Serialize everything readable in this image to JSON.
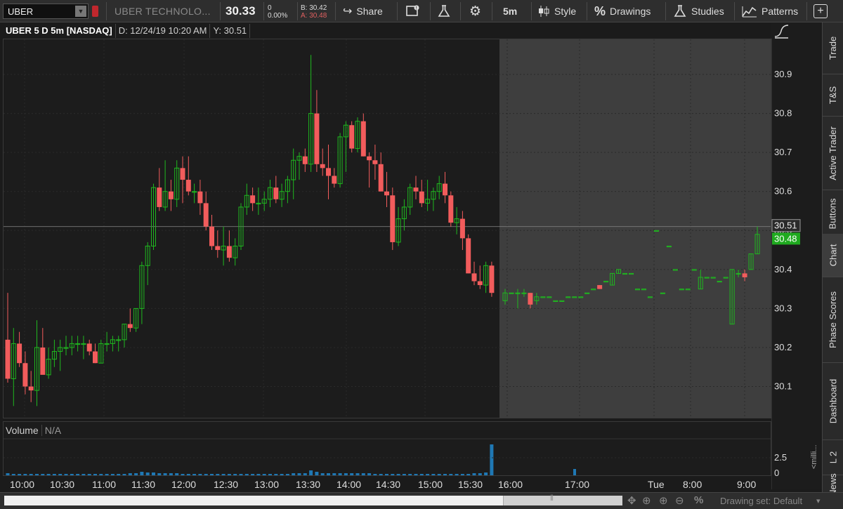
{
  "toolbar": {
    "symbol": "UBER",
    "company": "UBER TECHNOLO...",
    "last_price": "30.33",
    "change": "0",
    "change_pct": "0.00%",
    "bid": "B: 30.42",
    "ask": "A: 30.48",
    "share_label": "Share",
    "aggregation": "5m",
    "style_label": "Style",
    "drawings_label": "Drawings",
    "studies_label": "Studies",
    "patterns_label": "Patterns"
  },
  "chart_header": {
    "title": "UBER 5 D 5m [NASDAQ]",
    "date": "D: 12/24/19 10:20 AM",
    "y": "Y: 30.51"
  },
  "volume_header": {
    "label": "Volume",
    "value": "N/A"
  },
  "right_tabs": [
    "Trade",
    "T&S",
    "Active Trader",
    "Buttons",
    "Chart",
    "Phase Scores",
    "Dashboard",
    "L 2",
    "News"
  ],
  "bottom_bar": {
    "drawing_set": "Drawing set: Default"
  },
  "colors": {
    "up": "#1fb81f",
    "down": "#f25c5c",
    "volume": "#1f78b4",
    "extended_bg": "#3e3e3e",
    "last_tag": "#1faa1f"
  },
  "chart_data": {
    "type": "candlestick",
    "y_ticks": [
      "30.9",
      "30.8",
      "30.7",
      "30.6",
      "30.5",
      "30.4",
      "30.3",
      "30.2",
      "30.1"
    ],
    "ylim": [
      30.02,
      30.99
    ],
    "crosshair_price": "30.51",
    "last_price_tag": "30.48",
    "volume_ticks": [
      "2.5",
      "0"
    ],
    "volume_unit": "<milli...",
    "x_ticks": [
      "10:00",
      "10:30",
      "11:00",
      "11:30",
      "12:00",
      "12:30",
      "13:00",
      "13:30",
      "14:00",
      "14:30",
      "15:00",
      "15:30",
      "16:00",
      "17:00",
      "Tue",
      "8:00",
      "9:00"
    ],
    "regular_candles": [
      [
        30.22,
        30.34,
        30.11,
        30.12
      ],
      [
        30.12,
        30.25,
        30.05,
        30.21
      ],
      [
        30.21,
        30.24,
        30.15,
        30.16
      ],
      [
        30.16,
        30.19,
        30.08,
        30.1
      ],
      [
        30.1,
        30.14,
        30.06,
        30.09
      ],
      [
        30.09,
        30.27,
        30.05,
        30.2
      ],
      [
        30.2,
        30.25,
        30.15,
        30.13
      ],
      [
        30.13,
        30.2,
        30.12,
        30.17
      ],
      [
        30.17,
        30.22,
        30.15,
        30.19
      ],
      [
        30.19,
        30.22,
        30.14,
        30.2
      ],
      [
        30.2,
        30.23,
        30.18,
        30.2
      ],
      [
        30.2,
        30.23,
        30.18,
        30.21
      ],
      [
        30.21,
        30.23,
        30.19,
        30.21
      ],
      [
        30.21,
        30.23,
        30.17,
        30.21
      ],
      [
        30.21,
        30.22,
        30.18,
        30.19
      ],
      [
        30.19,
        30.21,
        30.16,
        30.16
      ],
      [
        30.16,
        30.22,
        30.16,
        30.21
      ],
      [
        30.21,
        30.24,
        30.19,
        30.21
      ],
      [
        30.21,
        30.23,
        30.19,
        30.22
      ],
      [
        30.22,
        30.23,
        30.19,
        30.22
      ],
      [
        30.22,
        30.26,
        30.2,
        30.26
      ],
      [
        30.26,
        30.3,
        30.24,
        30.25
      ],
      [
        30.25,
        30.3,
        30.24,
        30.3
      ],
      [
        30.3,
        30.42,
        30.26,
        30.41
      ],
      [
        30.41,
        30.47,
        30.36,
        30.46
      ],
      [
        30.46,
        30.62,
        30.45,
        30.61
      ],
      [
        30.61,
        30.66,
        30.55,
        30.56
      ],
      [
        30.56,
        30.68,
        30.55,
        30.6
      ],
      [
        30.6,
        30.63,
        30.55,
        30.58
      ],
      [
        30.58,
        30.68,
        30.56,
        30.66
      ],
      [
        30.66,
        30.69,
        30.57,
        30.63
      ],
      [
        30.63,
        30.69,
        30.59,
        30.6
      ],
      [
        30.6,
        30.62,
        30.57,
        30.6
      ],
      [
        30.6,
        30.63,
        30.54,
        30.57
      ],
      [
        30.57,
        30.6,
        30.5,
        30.51
      ],
      [
        30.51,
        30.54,
        30.45,
        30.46
      ],
      [
        30.46,
        30.5,
        30.43,
        30.45
      ],
      [
        30.45,
        30.51,
        30.41,
        30.46
      ],
      [
        30.46,
        30.5,
        30.42,
        30.43
      ],
      [
        30.43,
        30.48,
        30.41,
        30.46
      ],
      [
        30.46,
        30.57,
        30.45,
        30.56
      ],
      [
        30.56,
        30.62,
        30.54,
        30.59
      ],
      [
        30.59,
        30.61,
        30.55,
        30.57
      ],
      [
        30.57,
        30.61,
        30.54,
        30.57
      ],
      [
        30.57,
        30.6,
        30.55,
        30.58
      ],
      [
        30.58,
        30.63,
        30.56,
        30.61
      ],
      [
        30.61,
        30.64,
        30.57,
        30.58
      ],
      [
        30.58,
        30.62,
        30.56,
        30.6
      ],
      [
        30.6,
        30.64,
        30.57,
        30.63
      ],
      [
        30.63,
        30.71,
        30.58,
        30.68
      ],
      [
        30.68,
        30.7,
        30.63,
        30.69
      ],
      [
        30.69,
        30.71,
        30.65,
        30.67
      ],
      [
        30.67,
        30.95,
        30.65,
        30.8
      ],
      [
        30.8,
        30.86,
        30.65,
        30.67
      ],
      [
        30.67,
        30.71,
        30.64,
        30.66
      ],
      [
        30.66,
        30.72,
        30.58,
        30.64
      ],
      [
        30.64,
        30.66,
        30.61,
        30.62
      ],
      [
        30.62,
        30.75,
        30.61,
        30.74
      ],
      [
        30.74,
        30.78,
        30.65,
        30.77
      ],
      [
        30.77,
        30.78,
        30.7,
        30.71
      ],
      [
        30.71,
        30.79,
        30.7,
        30.78
      ],
      [
        30.78,
        30.8,
        30.69,
        30.69
      ],
      [
        30.69,
        30.7,
        30.61,
        30.68
      ],
      [
        30.68,
        30.72,
        30.63,
        30.67
      ],
      [
        30.67,
        30.7,
        30.6,
        30.6
      ],
      [
        30.6,
        30.65,
        30.56,
        30.59
      ],
      [
        30.59,
        30.61,
        30.45,
        30.47
      ],
      [
        30.47,
        30.56,
        30.46,
        30.53
      ],
      [
        30.53,
        30.58,
        30.5,
        30.56
      ],
      [
        30.56,
        30.62,
        30.54,
        30.61
      ],
      [
        30.61,
        30.64,
        30.58,
        30.6
      ],
      [
        30.6,
        30.63,
        30.56,
        30.57
      ],
      [
        30.57,
        30.63,
        30.55,
        30.58
      ],
      [
        30.58,
        30.61,
        30.55,
        30.6
      ],
      [
        30.6,
        30.64,
        30.58,
        30.62
      ],
      [
        30.62,
        30.65,
        30.57,
        30.59
      ],
      [
        30.59,
        30.6,
        30.51,
        30.52
      ],
      [
        30.52,
        30.56,
        30.49,
        30.53
      ],
      [
        30.53,
        30.55,
        30.45,
        30.48
      ],
      [
        30.48,
        30.49,
        30.39,
        30.39
      ],
      [
        30.39,
        30.42,
        30.36,
        30.37
      ],
      [
        30.37,
        30.41,
        30.35,
        30.36
      ],
      [
        30.36,
        30.42,
        30.34,
        30.41
      ],
      [
        30.41,
        30.42,
        30.33,
        30.34
      ]
    ],
    "extended_candles": [
      [
        30.32,
        30.35,
        30.31,
        30.34
      ],
      [
        30.34,
        30.34,
        30.34,
        30.34
      ],
      [
        30.34,
        30.35,
        30.3,
        30.34
      ],
      [
        30.34,
        30.35,
        30.33,
        30.34
      ],
      [
        30.34,
        30.34,
        30.3,
        30.31
      ],
      [
        30.32,
        30.34,
        30.31,
        30.33
      ],
      [
        30.33,
        30.33,
        30.33,
        30.33
      ],
      [
        30.33,
        30.33,
        30.33,
        30.33
      ],
      [
        30.32,
        30.32,
        30.32,
        30.32
      ],
      [
        30.32,
        30.32,
        30.32,
        30.32
      ],
      [
        30.33,
        30.33,
        30.33,
        30.33
      ],
      [
        30.33,
        30.33,
        30.33,
        30.33
      ],
      [
        30.33,
        30.33,
        30.33,
        30.33
      ],
      [
        30.34,
        30.34,
        30.34,
        30.34
      ],
      [
        30.35,
        30.35,
        30.35,
        30.35
      ],
      [
        30.36,
        30.36,
        30.35,
        30.35
      ],
      [
        30.37,
        30.37,
        30.37,
        30.37
      ],
      [
        30.36,
        30.39,
        30.36,
        30.39
      ],
      [
        30.39,
        30.4,
        30.39,
        30.4
      ],
      [
        30.39,
        30.39,
        30.39,
        30.39
      ],
      [
        30.39,
        30.39,
        30.39,
        30.39
      ],
      [
        30.35,
        30.35,
        30.35,
        30.35
      ],
      [
        30.35,
        30.35,
        30.35,
        30.35
      ],
      [
        30.33,
        30.33,
        30.33,
        30.33
      ],
      [
        30.5,
        30.5,
        30.5,
        30.5
      ],
      [
        30.34,
        30.34,
        30.34,
        30.34
      ],
      [
        30.46,
        30.46,
        30.46,
        30.46
      ],
      [
        30.4,
        30.4,
        30.4,
        30.4
      ],
      [
        30.35,
        30.35,
        30.35,
        30.35
      ],
      [
        30.35,
        30.35,
        30.35,
        30.35
      ],
      [
        30.4,
        30.4,
        30.4,
        30.4
      ],
      [
        30.35,
        30.4,
        30.35,
        30.38
      ],
      [
        30.38,
        30.38,
        30.38,
        30.38
      ],
      [
        30.38,
        30.38,
        30.38,
        30.38
      ],
      [
        30.37,
        30.37,
        30.37,
        30.37
      ],
      [
        30.38,
        30.38,
        30.38,
        30.38
      ],
      [
        30.26,
        30.4,
        30.26,
        30.4
      ],
      [
        30.39,
        30.4,
        30.38,
        30.39
      ],
      [
        30.39,
        30.4,
        30.37,
        30.38
      ],
      [
        30.4,
        30.44,
        30.4,
        30.44
      ],
      [
        30.44,
        30.51,
        30.44,
        30.49
      ]
    ],
    "volume": [
      0.3,
      0.2,
      0.2,
      0.2,
      0.2,
      0.2,
      0.2,
      0.2,
      0.2,
      0.2,
      0.2,
      0.2,
      0.2,
      0.2,
      0.2,
      0.2,
      0.2,
      0.2,
      0.2,
      0.2,
      0.2,
      0.3,
      0.3,
      0.5,
      0.4,
      0.4,
      0.3,
      0.3,
      0.3,
      0.3,
      0.2,
      0.2,
      0.2,
      0.2,
      0.2,
      0.2,
      0.2,
      0.2,
      0.2,
      0.2,
      0.2,
      0.2,
      0.2,
      0.2,
      0.2,
      0.2,
      0.2,
      0.2,
      0.2,
      0.3,
      0.3,
      0.3,
      0.7,
      0.5,
      0.3,
      0.3,
      0.3,
      0.3,
      0.3,
      0.3,
      0.3,
      0.3,
      0.3,
      0.2,
      0.2,
      0.2,
      0.2,
      0.2,
      0.2,
      0.2,
      0.2,
      0.2,
      0.2,
      0.2,
      0.2,
      0.2,
      0.2,
      0.2,
      0.2,
      0.2,
      0.3,
      0.3,
      0.4,
      4.4
    ],
    "extended_volume_spike": 0.9
  }
}
